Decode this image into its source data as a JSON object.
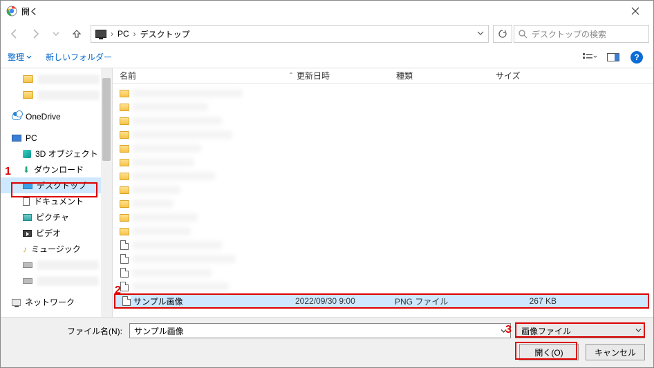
{
  "title": "開く",
  "nav": {
    "breadcrumbs": [
      "PC",
      "デスクトップ"
    ],
    "search_placeholder": "デスクトップの検索"
  },
  "toolbar": {
    "organize": "整理",
    "new_folder": "新しいフォルダー"
  },
  "tree": {
    "onedrive": "OneDrive",
    "pc": "PC",
    "children": {
      "objects3d": "3D オブジェクト",
      "downloads": "ダウンロード",
      "desktop": "デスクトップ",
      "documents": "ドキュメント",
      "pictures": "ピクチャ",
      "videos": "ビデオ",
      "music": "ミュージック"
    },
    "network": "ネットワーク"
  },
  "columns": {
    "name": "名前",
    "date": "更新日時",
    "type": "種類",
    "size": "サイズ"
  },
  "selected_file": {
    "name": "サンプル画像",
    "date": "2022/09/30 9:00",
    "type": "PNG ファイル",
    "size": "267 KB"
  },
  "bottom": {
    "filename_label": "ファイル名(N):",
    "filename_value": "サンプル画像",
    "filetype_value": "画像ファイル",
    "open": "開く(O)",
    "cancel": "キャンセル"
  },
  "callouts": {
    "one": "1",
    "two": "2",
    "three": "3"
  }
}
